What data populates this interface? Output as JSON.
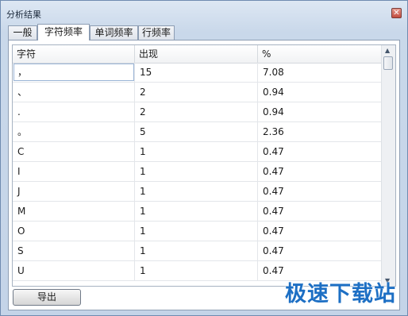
{
  "window": {
    "title": "分析结果",
    "close_glyph": "✕"
  },
  "tabs": [
    {
      "label": "一般",
      "active": false
    },
    {
      "label": "字符频率",
      "active": true
    },
    {
      "label": "单词频率",
      "active": false
    },
    {
      "label": "行频率",
      "active": false
    }
  ],
  "table": {
    "columns": [
      "字符",
      "出现",
      "%"
    ],
    "rows": [
      {
        "char": "，",
        "count": "15",
        "percent": "7.08"
      },
      {
        "char": "、",
        "count": "2",
        "percent": "0.94"
      },
      {
        "char": ".",
        "count": "2",
        "percent": "0.94"
      },
      {
        "char": "。",
        "count": "5",
        "percent": "2.36"
      },
      {
        "char": "C",
        "count": "1",
        "percent": "0.47"
      },
      {
        "char": "I",
        "count": "1",
        "percent": "0.47"
      },
      {
        "char": "J",
        "count": "1",
        "percent": "0.47"
      },
      {
        "char": "M",
        "count": "1",
        "percent": "0.47"
      },
      {
        "char": "O",
        "count": "1",
        "percent": "0.47"
      },
      {
        "char": "S",
        "count": "1",
        "percent": "0.47"
      },
      {
        "char": "U",
        "count": "1",
        "percent": "0.47"
      }
    ]
  },
  "scrollbar": {
    "up_icon": "scroll-up-arrow-icon",
    "down_icon": "scroll-down-arrow-icon"
  },
  "export_button": {
    "label": "导出"
  },
  "watermark": {
    "text": "极速下载站"
  },
  "colors": {
    "accent": "#1d6fc4",
    "close": "#c24c3f"
  }
}
